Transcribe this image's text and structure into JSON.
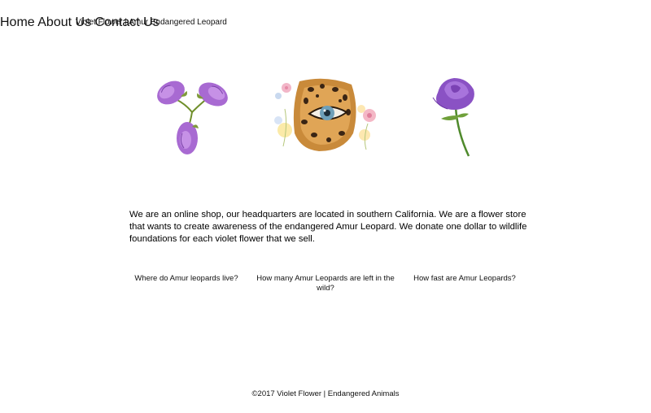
{
  "header": {
    "brand": "Violet Flower | Amur Endangered Leopard",
    "nav": [
      {
        "label": "Home"
      },
      {
        "label": "About Us"
      },
      {
        "label": "Contact Us"
      }
    ]
  },
  "hero": {
    "images": [
      {
        "icon": "triple-violet-flower-illustration"
      },
      {
        "icon": "leopard-eye-with-flowers-illustration"
      },
      {
        "icon": "violet-rose-illustration"
      }
    ]
  },
  "main": {
    "about": "We are an online shop, our headquarters are located in southern California. We are a flower store that wants to create awareness of the endangered Amur Leopard. We donate one dollar to wildlife foundations for each violet flower that we sell.",
    "faq_links": [
      {
        "label": "Where do Amur leopards live?"
      },
      {
        "label": "How many Amur Leopards are left in the wild?"
      },
      {
        "label": "How fast are Amur Leopards?"
      }
    ]
  },
  "footer": {
    "text": "©2017 Violet Flower | Endangered Animals"
  },
  "colors": {
    "violet": "#9b5fc9",
    "leaf": "#7f9a3a",
    "leopard": "#c98a3a",
    "eye": "#6e9fb8"
  }
}
